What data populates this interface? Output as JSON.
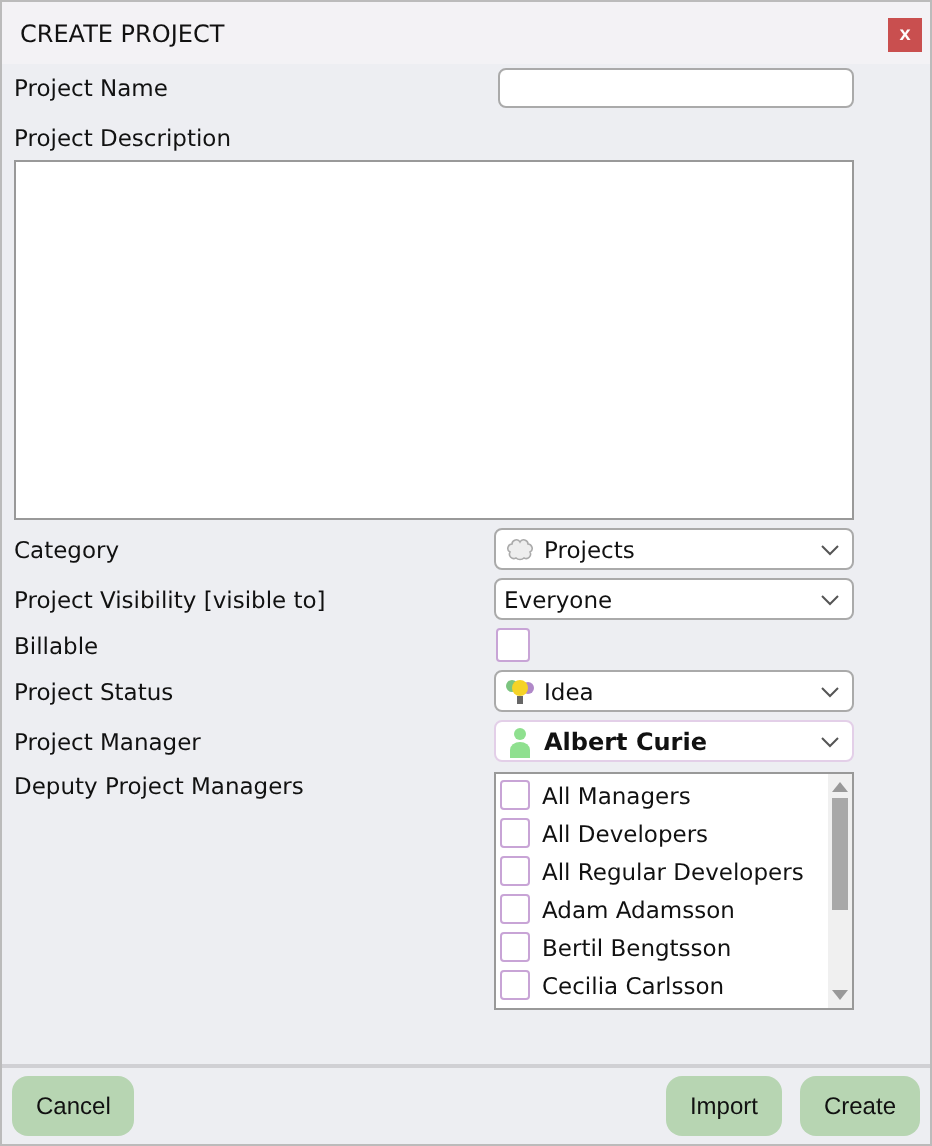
{
  "window": {
    "title": "CREATE PROJECT",
    "close": "x"
  },
  "project_name": {
    "label": "Project Name"
  },
  "project_description": {
    "label": "Project Description"
  },
  "category": {
    "label": "Category",
    "value": "Projects"
  },
  "visibility": {
    "label": "Project Visibility [visible to]",
    "value": "Everyone"
  },
  "billable": {
    "label": "Billable",
    "checked": false
  },
  "status": {
    "label": "Project Status",
    "value": "Idea"
  },
  "manager": {
    "label": "Project Manager",
    "value": "Albert Curie"
  },
  "deputies": {
    "label": "Deputy Project Managers",
    "items": [
      {
        "name": "All Managers",
        "checked": false
      },
      {
        "name": "All Developers",
        "checked": false
      },
      {
        "name": "All Regular Developers",
        "checked": false
      },
      {
        "name": "Adam Adamsson",
        "checked": false
      },
      {
        "name": "Bertil Bengtsson",
        "checked": false
      },
      {
        "name": "Cecilia Carlsson",
        "checked": false
      }
    ]
  },
  "buttons": {
    "left": [
      "Cancel"
    ],
    "right": [
      "Import",
      "Create"
    ]
  }
}
